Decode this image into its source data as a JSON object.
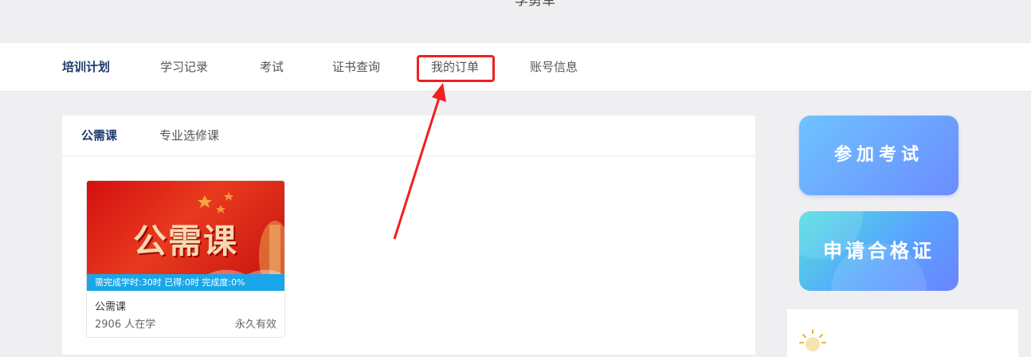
{
  "header": {
    "user_name": "李勇军"
  },
  "nav": {
    "items": [
      {
        "label": "培训计划"
      },
      {
        "label": "学习记录"
      },
      {
        "label": "考试"
      },
      {
        "label": "证书查询"
      },
      {
        "label": "我的订单"
      },
      {
        "label": "账号信息"
      }
    ],
    "active_index": 0,
    "highlighted_index": 4
  },
  "main": {
    "tabs": [
      {
        "label": "公需课"
      },
      {
        "label": "专业选修课"
      }
    ],
    "courses": [
      {
        "cover_title": "公需课",
        "progress_text": "需完成学时:30时 已得:0时 完成度:0%",
        "name": "公需课",
        "learners": "2906 人在学",
        "validity": "永久有效"
      }
    ]
  },
  "side": {
    "exam_button": "参加考试",
    "certificate_button": "申请合格证"
  },
  "colors": {
    "accent": "#1f3a6e",
    "highlight": "#f02020",
    "progress": "#1aa6e8"
  }
}
